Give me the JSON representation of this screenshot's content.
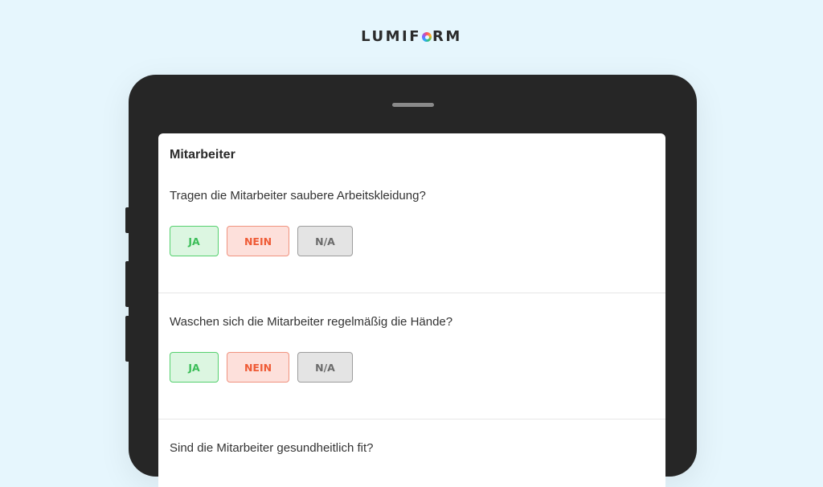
{
  "brand": {
    "prefix": "LUMIF",
    "suffix": "RM"
  },
  "form": {
    "section_title": "Mitarbeiter",
    "questions": [
      {
        "text": "Tragen die Mitarbeiter saubere Arbeitskleidung?",
        "options": [
          "JA",
          "NEIN",
          "N/A"
        ]
      },
      {
        "text": "Waschen sich die Mitarbeiter regelmäßig die Hände?",
        "options": [
          "JA",
          "NEIN",
          "N/A"
        ]
      },
      {
        "text": "Sind die Mitarbeiter gesundheitlich fit?"
      }
    ]
  },
  "colors": {
    "background": "#e6f6fd",
    "device": "#262626",
    "ja": "#3bbd58",
    "nein": "#ef5b36",
    "na": "#6b6b6b"
  }
}
